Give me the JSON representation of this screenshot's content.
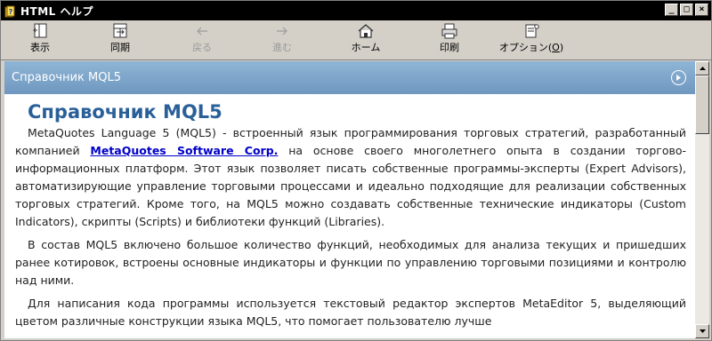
{
  "window": {
    "title": "HTML ヘルプ"
  },
  "toolbar": {
    "hide": "表示",
    "sync": "同期",
    "back": "戻る",
    "forward": "進む",
    "home": "ホーム",
    "print": "印刷",
    "options_prefix": "オプション(",
    "options_key": "O",
    "options_suffix": ")"
  },
  "content": {
    "header_title": "Справочник MQL5",
    "heading": "Справочник MQL5",
    "p1_a": "MetaQuotes Language 5 (MQL5) - встроенный язык программирования торговых стратегий, разработанный компанией ",
    "p1_link": "MetaQuotes Software Corp.",
    "p1_b": " на основе своего многолетнего опыта в создании торгово-информационных платформ. Этот язык позволяет писать собственные программы-эксперты (Expert Advisors), автоматизирующие управление торговыми процессами и идеально подходящие для реализации собственных торговых стратегий. Кроме того, на MQL5 можно создавать собственные технические индикаторы (Custom Indicators), скрипты (Scripts) и библиотеки функций (Libraries).",
    "p2": "В состав MQL5 включено большое количество функций, необходимых для анализа текущих и пришедших ранее котировок, встроены основные индикаторы и функции по управлению торговыми позициями и контролю над ними.",
    "p3": "Для написания кода программы используется текстовый редактор экспертов MetaEditor 5, выделяющий цветом различные конструкции языка MQL5, что помогает пользователю лучше"
  },
  "colors": {
    "title_bar": "#000000",
    "header_gradient_top": "#8fb5d6",
    "header_gradient_bottom": "#6f97bf",
    "heading": "#2a6099",
    "link": "#0000c8"
  },
  "icons": {
    "app": "help-book-icon",
    "hide": "hide-pane-icon",
    "sync": "sync-icon",
    "back": "back-arrow-icon",
    "forward": "forward-arrow-icon",
    "home": "home-icon",
    "print": "printer-icon",
    "options": "options-icon",
    "go": "circle-arrow-icon"
  }
}
